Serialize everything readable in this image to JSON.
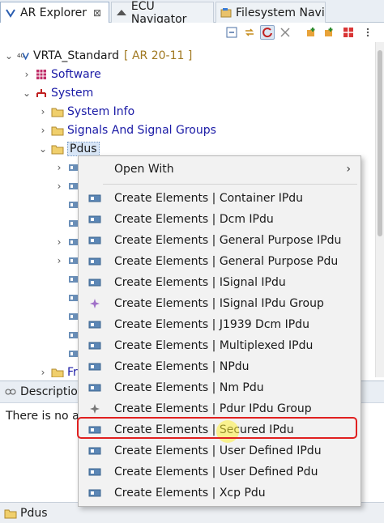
{
  "tabs": [
    {
      "label": "AR Explorer",
      "close": "⊠"
    },
    {
      "label": "ECU Navigator"
    },
    {
      "label": "Filesystem Navi"
    }
  ],
  "tree": {
    "root_label": "VRTA_Standard",
    "root_version": "[ AR 20-11 ]",
    "software_label": "Software",
    "system_label": "System",
    "system_info_label": "System Info",
    "signals_label": "Signals And Signal Groups",
    "pdus_label": "Pdus",
    "truncated_label": "Fr"
  },
  "context_menu": {
    "open_with": "Open With",
    "items": [
      "Create Elements | Container IPdu",
      "Create Elements | Dcm IPdu",
      "Create Elements | General Purpose IPdu",
      "Create Elements | General Purpose Pdu",
      "Create Elements | ISignal IPdu",
      "Create Elements | ISignal IPdu Group",
      "Create Elements | J1939 Dcm IPdu",
      "Create Elements | Multiplexed IPdu",
      "Create Elements | NPdu",
      "Create Elements | Nm Pdu",
      "Create Elements | Pdur IPdu Group",
      "Create Elements | Secured IPdu",
      "Create Elements | User Defined IPdu",
      "Create Elements | User Defined Pdu",
      "Create Elements | Xcp Pdu"
    ]
  },
  "description": {
    "tab_label": "Description",
    "text": "There is no ac"
  },
  "status": {
    "label": "Pdus"
  },
  "colors": {
    "highlight": "#e02020",
    "link": "#1a1aa6"
  }
}
